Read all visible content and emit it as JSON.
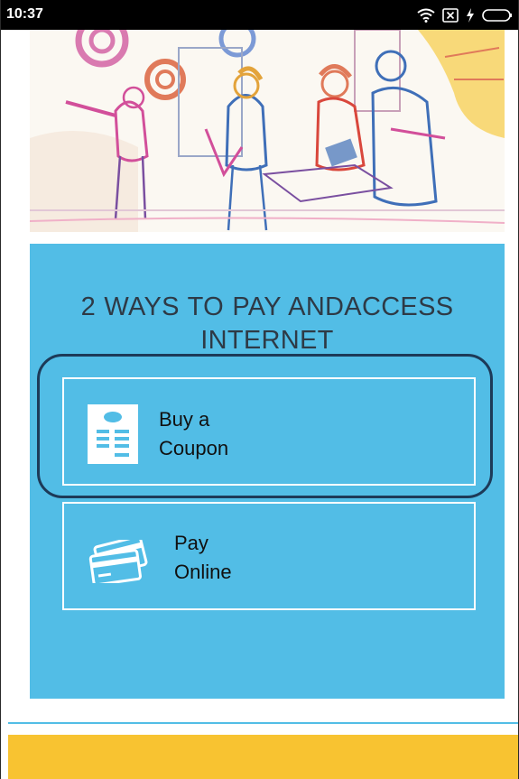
{
  "status_bar": {
    "time": "10:37",
    "icons": [
      "wifi-icon",
      "no-sim-icon",
      "charging-icon",
      "battery-icon"
    ]
  },
  "hero": {
    "image": "shopping-people-illustration"
  },
  "panel": {
    "title": "2 WAYS TO PAY ANDACCESS INTERNET",
    "options": [
      {
        "label_line1": "Buy a",
        "label_line2": "Coupon",
        "icon": "receipt-icon"
      },
      {
        "label_line1": "Pay",
        "label_line2": "Online",
        "icon": "credit-cards-icon"
      }
    ]
  },
  "colors": {
    "panel_blue": "#52bde6",
    "footer_yellow": "#f8c331",
    "highlight_ring": "#1d3a58",
    "title_text": "#2e3a46"
  }
}
